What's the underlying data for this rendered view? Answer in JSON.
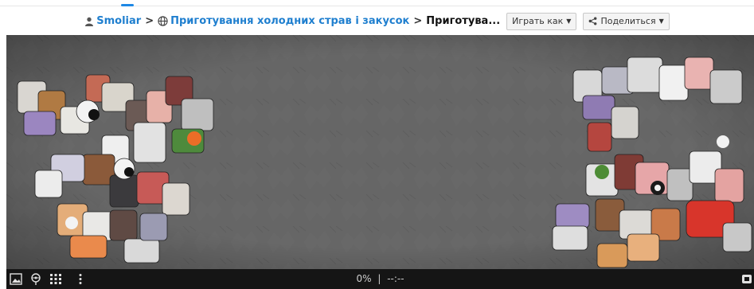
{
  "breadcrumb": {
    "user": "Smoliar",
    "sep1": ">",
    "category": "Приготування холодних страв і закусок",
    "sep2": ">",
    "current": "Приготува..."
  },
  "actions": {
    "play_as_label": "Играть как",
    "share_label": "Поделиться"
  },
  "status": {
    "progress": "0%",
    "divider": "|",
    "timer": "--:--"
  },
  "colors": {
    "board_bg": "#606060",
    "bottom_bar": "#151515",
    "link": "#1f7fcf"
  },
  "icons": [
    "user-icon",
    "globe-icon",
    "chevron-down-icon",
    "share-icon",
    "image-icon",
    "ghost-icon",
    "grid-icon",
    "more-icon",
    "fullscreen-icon"
  ]
}
